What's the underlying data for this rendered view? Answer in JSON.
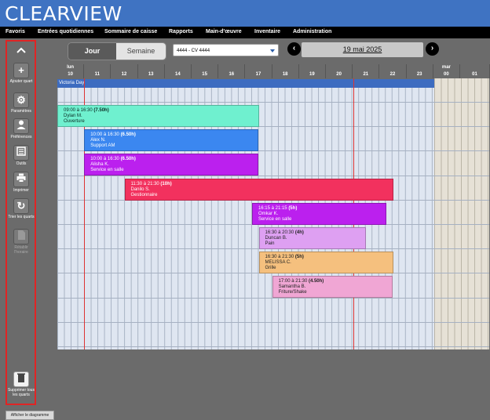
{
  "app": {
    "logo": "CLEARVIEW"
  },
  "nav": {
    "items": [
      "Favoris",
      "Entrées quotidiennes",
      "Sommaire de caisse",
      "Rapports",
      "Main-d'œuvre",
      "Inventaire",
      "Administration"
    ]
  },
  "sidebar": {
    "collapse_icon": "chevron-up-icon",
    "buttons": [
      {
        "label": "Ajouter quart",
        "icon": "plus-icon",
        "enabled": true
      },
      {
        "label": "Paramètres",
        "icon": "gear-icon",
        "enabled": true
      },
      {
        "label": "Préférences",
        "icon": "person-icon",
        "enabled": true
      },
      {
        "label": "Outils",
        "icon": "book-icon",
        "enabled": true
      },
      {
        "label": "Imprimer",
        "icon": "printer-icon",
        "enabled": true
      },
      {
        "label": "Trier les quarts",
        "icon": "refresh-icon",
        "enabled": true
      },
      {
        "label": "Rétablir l'horaire",
        "icon": "document-icon",
        "enabled": false
      },
      {
        "label": "Supprimer tous les quarts",
        "icon": "trash-icon",
        "enabled": true
      }
    ],
    "footer_tab": "Afficher le diagramme"
  },
  "toolbar": {
    "view_tabs": [
      {
        "label": "Jour",
        "active": true
      },
      {
        "label": "Semaine",
        "active": false
      }
    ],
    "store_select": "4444 - CV 4444",
    "prev_icon": "chevron-left-icon",
    "next_icon": "chevron-right-icon",
    "date": "19 mai 2025"
  },
  "schedule": {
    "day_label": "lun",
    "next_day_label": "mar",
    "hours": [
      "10",
      "11",
      "12",
      "13",
      "14",
      "15",
      "16",
      "17",
      "18",
      "19",
      "20",
      "21",
      "22",
      "23"
    ],
    "next_hours": [
      "00",
      "01"
    ],
    "holiday": "Victoria Day",
    "shifts": [
      {
        "time": "09:00 à 16:30",
        "hours": "(7.50h)",
        "name": "Dylan M.",
        "role": "Ouverture",
        "color": "#6ff0cf",
        "text_color": "#0b2a22"
      },
      {
        "time": "10:00 à 16:30",
        "hours": "(6.50h)",
        "name": "Alex N.",
        "role": "Support AM",
        "color": "#3b87f0",
        "text_color": "#ffffff"
      },
      {
        "time": "10:00 à 16:30",
        "hours": "(6.50h)",
        "name": "Alisha K.",
        "role": "Service en salle",
        "color": "#bb20ee",
        "text_color": "#ffffff"
      },
      {
        "time": "11:30 à 21:30",
        "hours": "(10h)",
        "name": "Danilo S.",
        "role": "Gestionnaire",
        "color": "#f2315e",
        "text_color": "#ffffff"
      },
      {
        "time": "16:15 à 21:15",
        "hours": "(5h)",
        "name": "Omkar K.",
        "role": "Service en salle",
        "color": "#bb20ee",
        "text_color": "#ffffff"
      },
      {
        "time": "16:30 à 20:30",
        "hours": "(4h)",
        "name": "Duncan B.",
        "role": "Pain",
        "color": "#dea0f2",
        "text_color": "#222222"
      },
      {
        "time": "16:30 à 21:30",
        "hours": "(5h)",
        "name": "MELISSA C.",
        "role": "Grille",
        "color": "#f5c07e",
        "text_color": "#222222"
      },
      {
        "time": "17:00 à 21:30",
        "hours": "(4.50h)",
        "name": "Samantha B.",
        "role": "Friture/Shake",
        "color": "#f0a6d4",
        "text_color": "#222222"
      }
    ]
  }
}
